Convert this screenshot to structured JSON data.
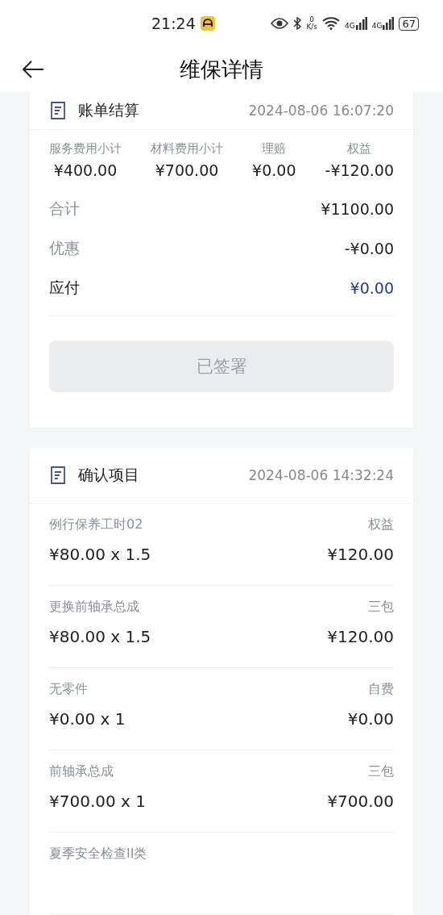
{
  "status_bar": {
    "time": "21:24",
    "net_speed": "0",
    "net_unit": "K/s",
    "signal_1": "4G",
    "signal_2": "4G",
    "battery": "67"
  },
  "nav": {
    "title": "维保详情"
  },
  "bill": {
    "title": "账单结算",
    "time": "2024-08-06 16:07:20",
    "subtotals": [
      {
        "label": "服务费用小计",
        "value": "¥400.00"
      },
      {
        "label": "材料费用小计",
        "value": "¥700.00"
      },
      {
        "label": "理赔",
        "value": "¥0.00"
      },
      {
        "label": "权益",
        "value": "-¥120.00"
      }
    ],
    "rows": [
      {
        "kind": "muted",
        "label": "合计",
        "value": "¥1100.00"
      },
      {
        "kind": "muted",
        "label": "优惠",
        "value": "-¥0.00"
      },
      {
        "kind": "payable",
        "label": "应付",
        "value": "¥0.00"
      }
    ],
    "button": {
      "label": "已签署",
      "disabled": true
    }
  },
  "items_card": {
    "title": "确认项目",
    "time": "2024-08-06 14:32:24",
    "items": [
      {
        "name": "例行保养工时02",
        "type": "权益",
        "price": "¥80.00 x 1.5",
        "total": "¥120.00"
      },
      {
        "name": "更换前轴承总成",
        "type": "三包",
        "price": "¥80.00 x 1.5",
        "total": "¥120.00"
      },
      {
        "name": "无零件",
        "type": "自费",
        "price": "¥0.00 x 1",
        "total": "¥0.00"
      },
      {
        "name": "前轴承总成",
        "type": "三包",
        "price": "¥700.00 x 1",
        "total": "¥700.00"
      },
      {
        "name": "夏季安全检查II类"
      }
    ]
  }
}
